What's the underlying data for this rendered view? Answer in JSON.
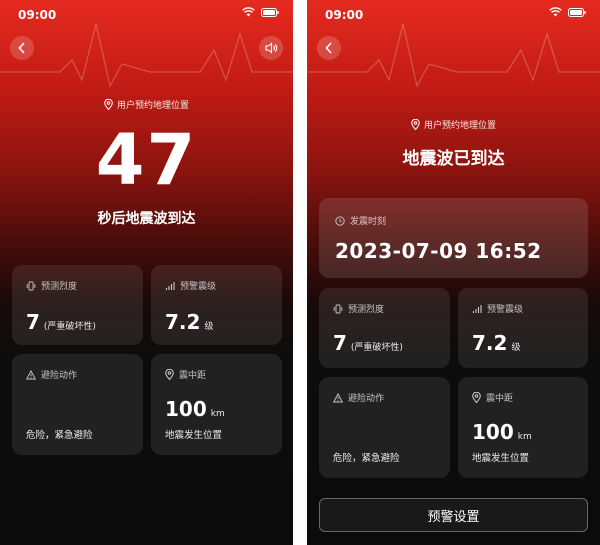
{
  "status_bar": {
    "time": "09:00"
  },
  "colors": {
    "accent_red": "#e52a1f",
    "card_bg": "#1e1e1e"
  },
  "left_screen": {
    "location_label": "用户预约地理位置",
    "countdown_value": "47",
    "countdown_caption": "秒后地震波到达",
    "cards": {
      "intensity": {
        "label": "预测烈度",
        "value": "7",
        "unit": "(严重破坏性)"
      },
      "magnitude": {
        "label": "预警震级",
        "value": "7.2",
        "unit": "级"
      },
      "action": {
        "label": "避险动作",
        "note": "危险，紧急避险"
      },
      "distance": {
        "label": "震中距",
        "value": "100",
        "unit": "km",
        "note": "地震发生位置"
      }
    }
  },
  "right_screen": {
    "location_label": "用户预约地理位置",
    "title": "地震波已到达",
    "time_card": {
      "label": "发震时刻",
      "value": "2023-07-09 16:52"
    },
    "cards": {
      "intensity": {
        "label": "预测烈度",
        "value": "7",
        "unit": "(严重破坏性)"
      },
      "magnitude": {
        "label": "预警震级",
        "value": "7.2",
        "unit": "级"
      },
      "action": {
        "label": "避险动作",
        "note": "危险，紧急避险"
      },
      "distance": {
        "label": "震中距",
        "value": "100",
        "unit": "km",
        "note": "地震发生位置"
      }
    },
    "settings_button": "预警设置"
  }
}
